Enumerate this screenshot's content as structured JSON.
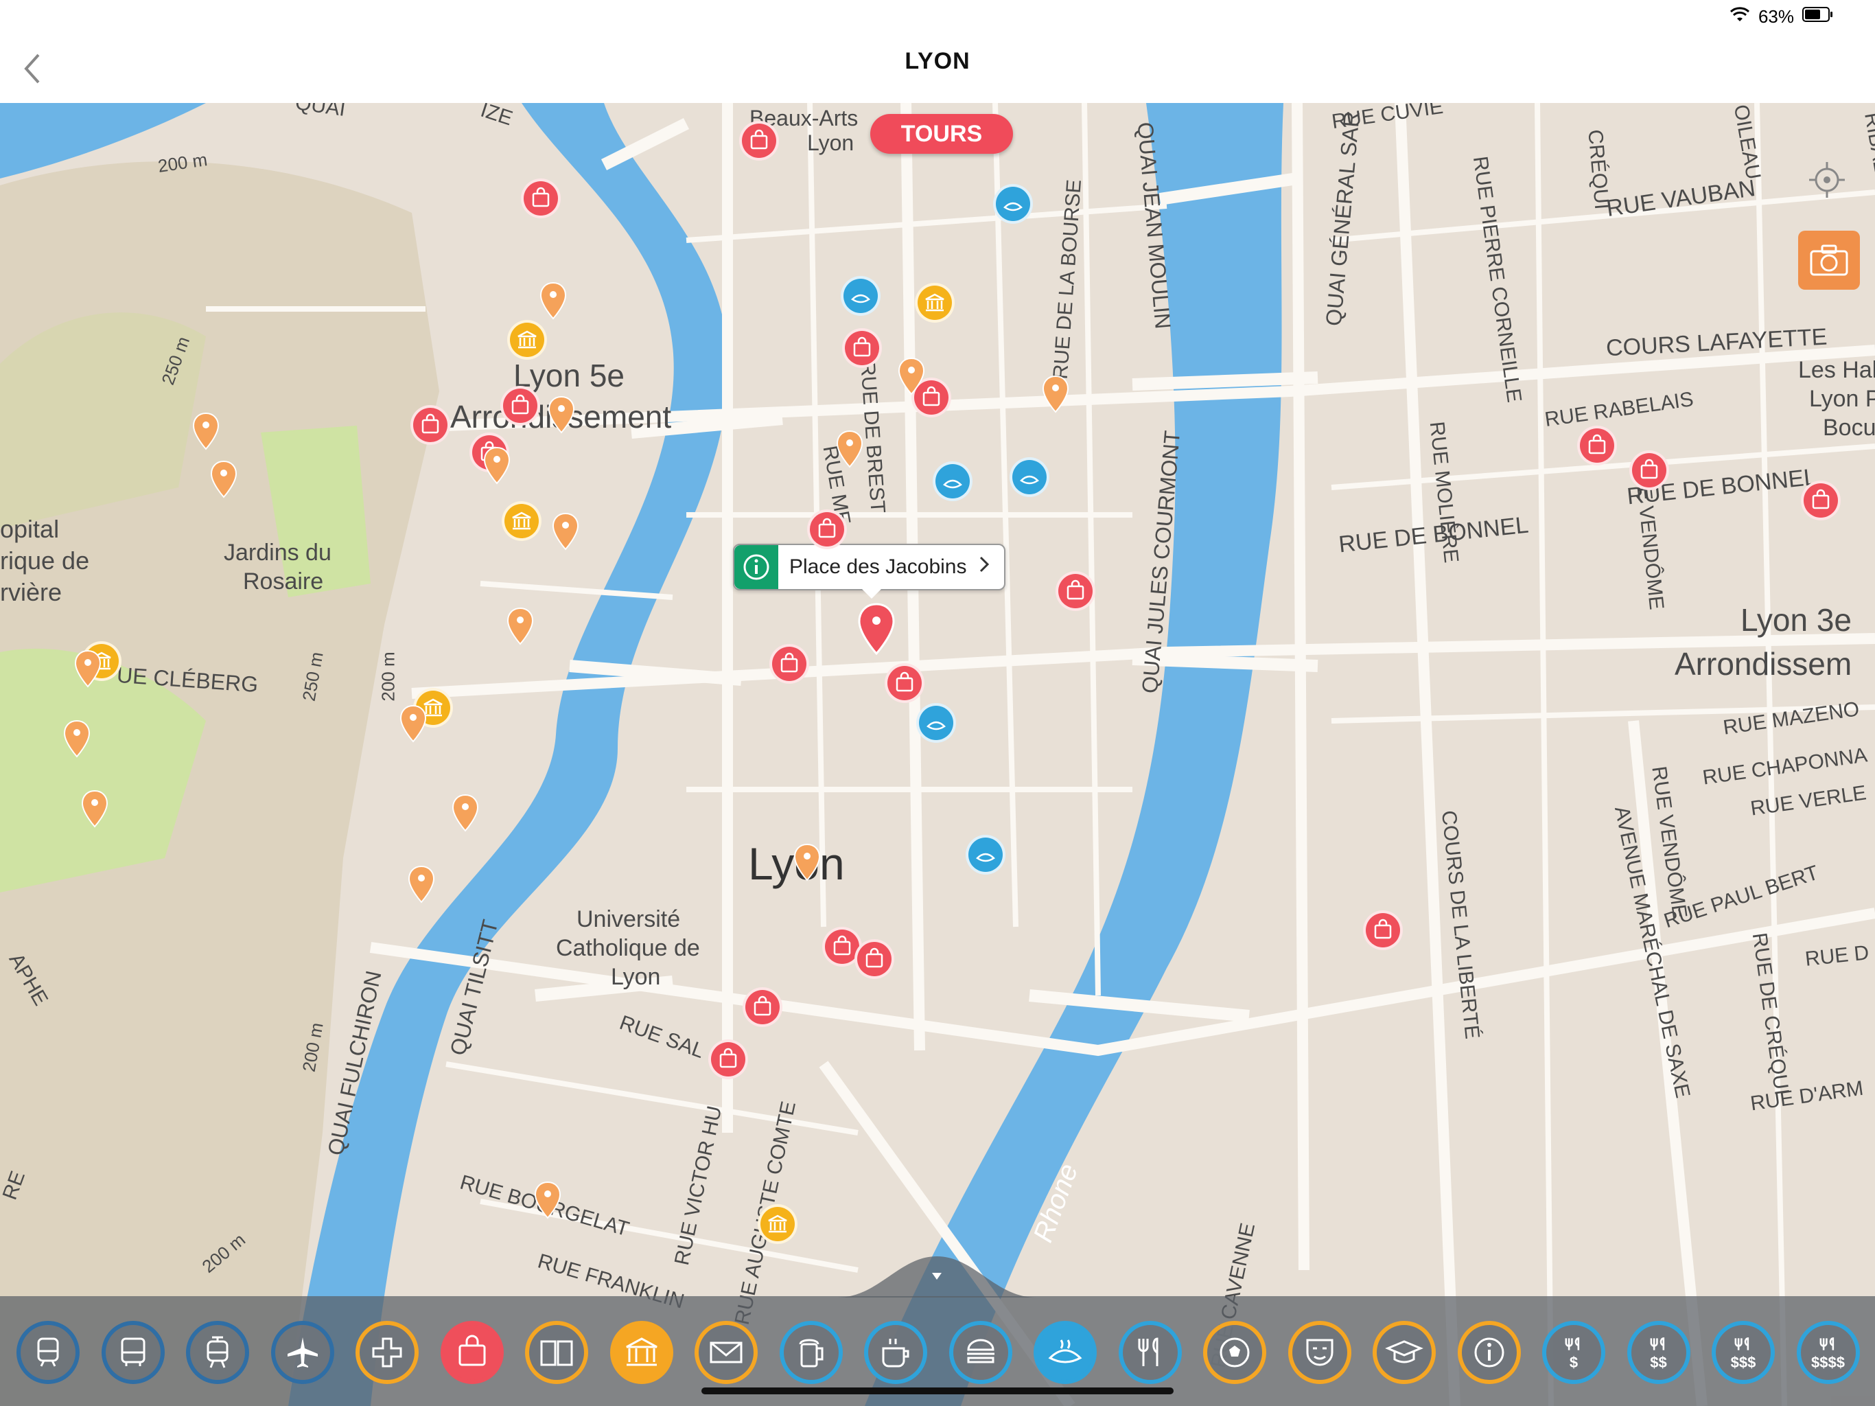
{
  "status": {
    "battery": "63%"
  },
  "nav": {
    "title": "LYON"
  },
  "tours_button": "TOURS",
  "callout": {
    "title": "Place des Jacobins"
  },
  "map": {
    "labels": {
      "beaux_arts": "Beaux-Arts",
      "lyon_small": "Lyon",
      "lyon5": "Lyon 5e",
      "arr5": "Arrondissement",
      "jardins": "Jardins du",
      "rosaire": "Rosaire",
      "hopital1": "opital",
      "hopital2": "rique de",
      "hopital3": "rvière",
      "cleberg": "UE CLÉBERG",
      "lyon_city": "Lyon",
      "univ1": "Université",
      "univ2": "Catholique de",
      "univ3": "Lyon",
      "lyon3": "Lyon 3e",
      "arr3": "Arrondissem",
      "halles1": "Les Hall",
      "halles2": "Lyon P",
      "halles3": "Bocu",
      "rhone": "Rhone",
      "quai_fulchiron": "QUAI FULCHIRON",
      "quai_tilsitt": "QUAI TILSITT",
      "quai_jean_moulin": "QUAI JEAN MOULIN",
      "quai_jules_courmont": "QUAI JULES COURMONT",
      "quai_general_sarrail": "QUAI GÉNÉRAL SAR",
      "rue_bourse": "RUE DE LA BOURSE",
      "rue_brest": "RUE DE BREST",
      "rue_mercie": "RUE ME",
      "rue_cuvier": "RUE CUVIE",
      "rue_vauban": "RUE VAUBAN",
      "rue_pierre_corneille": "RUE PIERRE CORNEILLE",
      "rue_creq": "CRÉQUI",
      "cours_lafayette": "COURS LAFAYETTE",
      "rue_rabelais": "RUE RABELAIS",
      "rue_moliere": "RUE MOLIÈRE",
      "rue_bonnel": "RUE DE BONNEL",
      "rue_bonnel2": "RUE DE BONNEL",
      "rue_vendome": "RUE VENDÔME",
      "rue_mazenod": "RUE MAZENO",
      "rue_chaponnay": "RUE CHAPONNA",
      "rue_verlet": "RUE VERLE",
      "cours_liberte": "COURS DE LA LIBERTÉ",
      "av_saxe": "AVENUE MARÉCHAL DE SAXE",
      "rue_vendome2": "RUE VENDÔME",
      "rue_paul_bert": "RUE PAUL BERT",
      "rue_creq2": "RUE DE CRÉQUI",
      "rue_d": "RUE D",
      "rue_darm": "RUE D'ARM",
      "rue_sala": "RUE SAL",
      "rue_victor_hugo": "RUE VICTOR HU",
      "rue_auguste_comte": "RUE AUGUSTE COMTE",
      "rue_bourgelat": "RUE BOURGELAT",
      "rue_franklin": "RUE FRANKLIN",
      "rue_cavenne": "RUE CAVENNE",
      "m200a": "200 m",
      "m250a": "250 m",
      "m250b": "250 m",
      "m200b": "200 m",
      "m200c": "200 m",
      "m200d": "200 m",
      "raphe": "APHE",
      "re": "RE",
      "quai_cel": "QUAI",
      "ize": "IZE",
      "rue_boil": "OILEAU",
      "ribal": "RIBAL"
    }
  },
  "toolbar": {
    "items": [
      {
        "name": "train",
        "color": "#2f6ea5"
      },
      {
        "name": "bus",
        "color": "#2f6ea5"
      },
      {
        "name": "tram",
        "color": "#2f6ea5"
      },
      {
        "name": "airplane",
        "color": "#2f6ea5"
      },
      {
        "name": "medical-cross",
        "color": "#f5a623"
      },
      {
        "name": "shopping",
        "color": "#ef4f5b"
      },
      {
        "name": "book",
        "color": "#f5a623"
      },
      {
        "name": "museum",
        "color": "#f5a623"
      },
      {
        "name": "mail",
        "color": "#f5a623"
      },
      {
        "name": "beer",
        "color": "#2fa3db"
      },
      {
        "name": "coffee",
        "color": "#2fa3db"
      },
      {
        "name": "burger",
        "color": "#2fa3db"
      },
      {
        "name": "bakery",
        "color": "#2fa3db"
      },
      {
        "name": "restaurant",
        "color": "#2fa3db"
      },
      {
        "name": "soccer",
        "color": "#f5a623"
      },
      {
        "name": "theatre",
        "color": "#f5a623"
      },
      {
        "name": "education",
        "color": "#f5a623"
      },
      {
        "name": "info",
        "color": "#f5a623"
      },
      {
        "name": "restaurant-1",
        "color": "#2fa3db"
      },
      {
        "name": "restaurant-2",
        "color": "#2fa3db"
      },
      {
        "name": "restaurant-3",
        "color": "#2fa3db"
      },
      {
        "name": "restaurant-4",
        "color": "#2fa3db"
      }
    ],
    "price_labels": [
      "$",
      "$$",
      "$$$",
      "$$$$"
    ]
  },
  "colors": {
    "water": "#6cb4e6",
    "land": "#e9e1d8",
    "park": "#cfe3a3",
    "accent": "#f04b5a"
  }
}
